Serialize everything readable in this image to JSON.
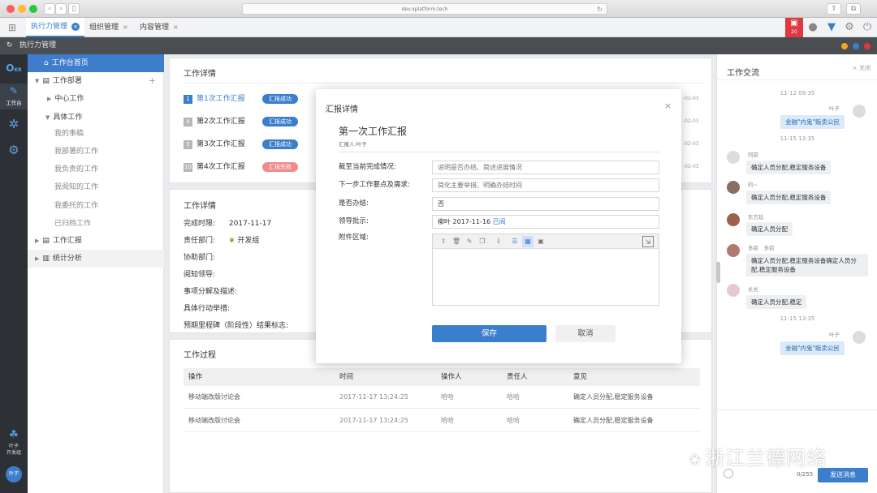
{
  "browser": {
    "url": "dev.xplatform.tech"
  },
  "tabs": [
    {
      "label": "执行力管理"
    },
    {
      "label": "组织管理"
    },
    {
      "label": "内容管理"
    }
  ],
  "notify_count": "20",
  "app_title": "执行力管理",
  "rail": {
    "workbench": "工作台",
    "user_name": "叶子",
    "user_team": "开发组",
    "user_avatar": "叶子"
  },
  "sidebar": {
    "home": "工作台首页",
    "dept": "工作部署",
    "center": "中心工作",
    "specific": "具体工作",
    "items": [
      "我的事稿",
      "我部署的工作",
      "我负责的工作",
      "我阅知的工作",
      "我委托的工作",
      "已归档工作"
    ],
    "report": "工作汇报",
    "stats": "统计分析"
  },
  "reports": {
    "title": "工作详情",
    "rows": [
      {
        "num": "1",
        "label": "第1次工作汇报",
        "status": "汇报成功",
        "date": "-02-03"
      },
      {
        "num": "4",
        "label": "第2次工作汇报",
        "status": "汇报成功",
        "date": "-02-03"
      },
      {
        "num": "5",
        "label": "第3次工作汇报",
        "status": "汇报成功",
        "date": "-02-03"
      },
      {
        "num": "10",
        "label": "第4次工作汇报",
        "status": "汇报失败",
        "date": "-02-03"
      }
    ]
  },
  "detail": {
    "title": "工作详情",
    "deadline_label": "完成时限:",
    "deadline": "2017-11-17",
    "dept_label": "责任部门:",
    "dept": "开发组",
    "assist_label": "协助部门:",
    "reader_label": "阅知领导:",
    "desc_label": "事项分解及描述:",
    "action_label": "具体行动举措:",
    "milestone_label": "预期里程碑（阶段性）结果标志:"
  },
  "process": {
    "title": "工作过程",
    "headers": [
      "操作",
      "时间",
      "操作人",
      "责任人",
      "意见"
    ],
    "rows": [
      [
        "移动端改版讨论会",
        "2017-11-17 13:24:25",
        "哈哈",
        "哈哈",
        "确定人员分配,稳定服务设备"
      ],
      [
        "移动端改版讨论会",
        "2017-11-17 13:24:25",
        "哈哈",
        "哈哈",
        "确定人员分配,稳定服务设备"
      ]
    ]
  },
  "chat": {
    "title": "工作交流",
    "close": "关闭",
    "messages": [
      {
        "time": "11-12 09:35"
      },
      {
        "name": "叶子",
        "text": "金融\"内鬼\"贩卖公民",
        "me": true
      },
      {
        "time": "11-15 13:35"
      },
      {
        "name": "同前",
        "text": "确定人员分配,稳定服务设备"
      },
      {
        "name": "的~",
        "text": "确定人员分配,稳定服务设备"
      },
      {
        "name": "东方玖",
        "text": "确定人员分配"
      },
      {
        "name": "多前　多前",
        "text": "确定人员分配,稳定服务设备确定人员分配,稳定服务设备"
      },
      {
        "name": "长长",
        "text": "确定人员分配,稳定"
      },
      {
        "time": "11-15 13:35"
      },
      {
        "name": "叶子",
        "text": "金融\"内鬼\"贩卖公民",
        "me": true
      }
    ],
    "counter": "0/255",
    "send": "发送消息"
  },
  "modal": {
    "title": "汇报详情",
    "report_title": "第一次工作汇报",
    "reporter": "汇报人:叶子",
    "f1_label": "截至当前完成情况:",
    "f1_placeholder": "说明是否办结、简述进展情况",
    "f2_label": "下一步工作要点及需求:",
    "f2_placeholder": "简化主要举措，明确办结时间",
    "f3_label": "是否办结:",
    "f3_value": "否",
    "f4_label": "领导批示:",
    "f4_value": "柳叶 2017-11-16",
    "f4_read": "已阅",
    "f5_label": "附件区域:",
    "save": "保存",
    "cancel": "取消"
  },
  "watermark": "浙江兰德网络",
  "colors": {
    "accent": "#3b7ecb",
    "fail": "#f08c8c",
    "dark": "#2d3135",
    "notify": "#e0383e"
  }
}
